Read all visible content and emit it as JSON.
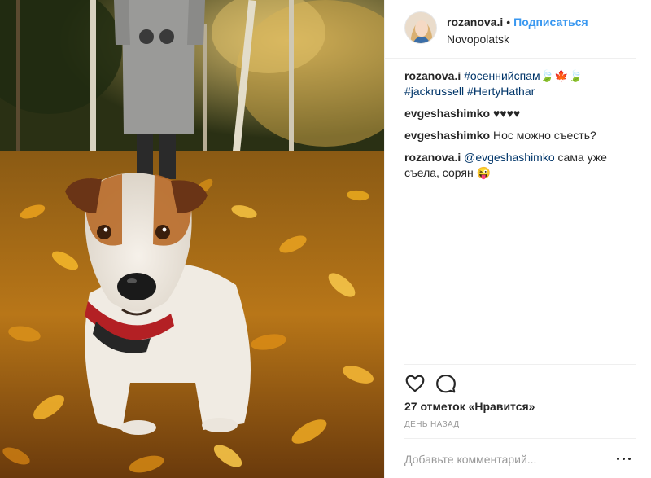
{
  "post": {
    "image_alt": "Jack Russell terrier sitting on autumn leaves",
    "author": {
      "username": "rozanova.i",
      "separator": "•",
      "follow_label": "Подписаться",
      "location": "Novopolatsk"
    },
    "caption": {
      "username": "rozanova.i",
      "tag_1": "#осеннийспам",
      "emoji": "🍃🍁🍃",
      "tag_2": "#jackrussell",
      "tag_3": "#HertyHathar"
    },
    "comments": [
      {
        "username": "evgeshashimko",
        "text": "♥♥♥♥"
      },
      {
        "username": "evgeshashimko",
        "text": "Нос можно съесть?"
      },
      {
        "username": "rozanova.i",
        "mention": "@evgeshashimko",
        "text": "сама уже съела, сорян 😜"
      }
    ],
    "actions": {
      "like_icon": "heart-icon",
      "comment_icon": "speech-bubble-icon"
    },
    "likes_text": "27 отметок «Нравится»",
    "timestamp": "День назад",
    "add_comment": {
      "placeholder": "Добавьте комментарий...",
      "more_icon": "ellipsis-icon"
    }
  },
  "colors": {
    "link": "#3897f0",
    "hashtag": "#003569",
    "muted": "#999999",
    "border": "#efefef",
    "text": "#262626"
  }
}
